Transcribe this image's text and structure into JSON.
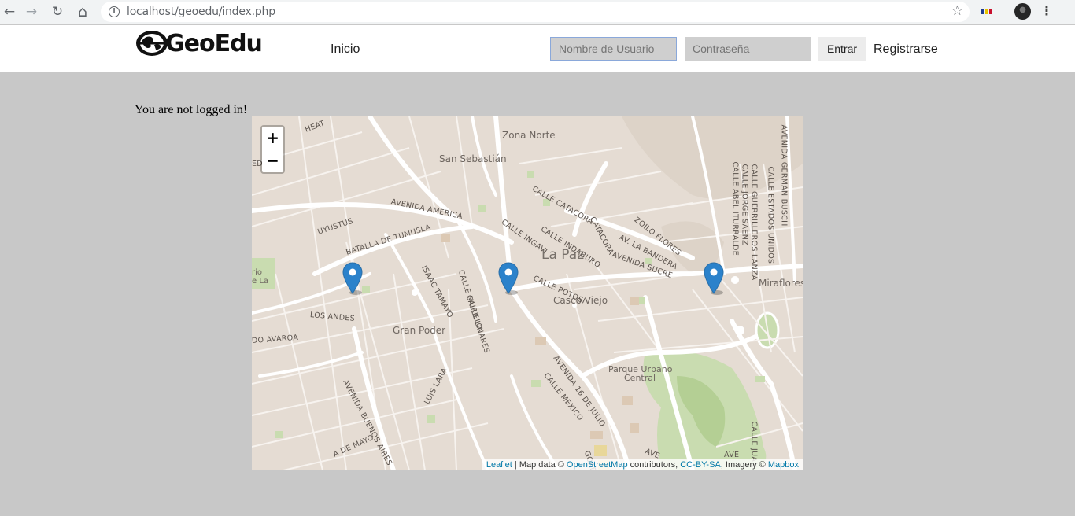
{
  "browser": {
    "url": "localhost/geoedu/index.php",
    "back_icon": "←",
    "forward_icon": "→",
    "reload_icon": "↻",
    "home_icon": "⌂",
    "info_icon": "i",
    "star_icon": "☆",
    "menu_icon": "⋮"
  },
  "nav": {
    "logo_text": "GeoEdu",
    "inicio": "Inicio",
    "username_placeholder": "Nombre de Usuario",
    "password_placeholder": "Contraseña",
    "login_button": "Entrar",
    "register_link": "Registrarse"
  },
  "main": {
    "status_message": "You are not logged in!"
  },
  "map": {
    "zoom_in": "+",
    "zoom_out": "−",
    "city_label": "La Paz",
    "markers": 3,
    "place_labels": {
      "zona_norte": "Zona Norte",
      "san_sebastian": "San Sebastián",
      "casco_viejo": "Casco Viejo",
      "gran_poder": "Gran Poder",
      "parque_urbano_1": "Parque Urbano",
      "parque_urbano_2": "Central",
      "miraflores": "Miraflores",
      "rio": "rio",
      "la": "e La",
      "heat": "HEAT",
      "ed": "ED"
    },
    "street_labels": {
      "avenida_america": "AVENIDA AMERICA",
      "uyustus": "UYUSTUS",
      "batalla": "BATALLA DE TUMUSLA",
      "isaac": "ISAAC TAMAYO",
      "murillo": "CALLE MURILLO",
      "linares": "CALLE LINARES",
      "ingavi": "CALLE INGAVI",
      "indaburo": "CALLE INDABURO",
      "catacora": "CALLE CATACORA",
      "catacora2": "CATACORA",
      "potosi": "CALLE POTOSI",
      "bandera": "AV. LA BANDERA",
      "zoilo": "ZOILO FLORES",
      "sucre": "AVENIDA SUCRE",
      "los_andes": "LOS ANDES",
      "avaroa": "DO AVAROA",
      "buenos_aires": "AVENIDA BUENOS AIRES",
      "luis_lara": "LUIS LARA",
      "de_mayo": "A DE MAYO",
      "julio": "AVENIDA 16 DE JULIO",
      "mexico": "CALLE MEXICO",
      "goaeta": "GOAETA",
      "german_busch": "AVENIDA GERMAN BUSCH",
      "estados_unidos": "CALLE ESTADOS UNIDOS",
      "guerrilleros": "CALLE GUERRILLEROS LANZA",
      "jorge_saenz": "CALLE JORGE SAENZ",
      "abel": "CALLE ABEL ITURRALDE",
      "juan": "CALLE JUAN D",
      "ave": "AVE",
      "ave2": "AVE"
    },
    "attribution": {
      "leaflet": "Leaflet",
      "text1": " | Map data © ",
      "osm": "OpenStreetMap",
      "text2": " contributors, ",
      "license": "CC-BY-SA",
      "text3": ", Imagery © ",
      "mapbox": "Mapbox"
    },
    "colors": {
      "background": "#e5dcd3",
      "road": "#ffffff",
      "park": "#c9dcb0",
      "marker": "#2b82cb"
    }
  }
}
